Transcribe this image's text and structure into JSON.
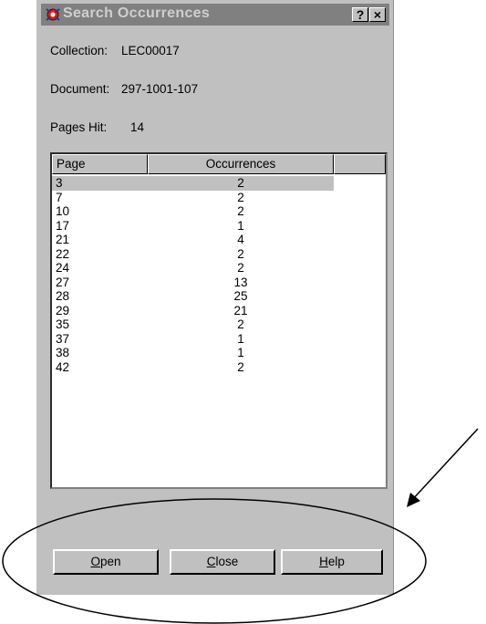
{
  "window": {
    "title": "Search Occurrences",
    "help_glyph": "?",
    "close_glyph": "×",
    "icon": "search-occurrences-app-icon"
  },
  "fields": {
    "collection_label": "Collection:",
    "collection_value": "LEC00017",
    "document_label": "Document:",
    "document_value": "297-1001-107",
    "pages_hit_label": "Pages Hit:",
    "pages_hit_value": "14"
  },
  "table": {
    "columns": [
      "Page",
      "Occurrences",
      ""
    ],
    "rows": [
      {
        "page": "3",
        "occurrences": "2",
        "selected": true
      },
      {
        "page": "7",
        "occurrences": "2"
      },
      {
        "page": "10",
        "occurrences": "2"
      },
      {
        "page": "17",
        "occurrences": "1"
      },
      {
        "page": "21",
        "occurrences": "4"
      },
      {
        "page": "22",
        "occurrences": "2"
      },
      {
        "page": "24",
        "occurrences": "2"
      },
      {
        "page": "27",
        "occurrences": "13"
      },
      {
        "page": "28",
        "occurrences": "25"
      },
      {
        "page": "29",
        "occurrences": "21"
      },
      {
        "page": "35",
        "occurrences": "2"
      },
      {
        "page": "37",
        "occurrences": "1"
      },
      {
        "page": "38",
        "occurrences": "1"
      },
      {
        "page": "42",
        "occurrences": "2"
      }
    ]
  },
  "buttons": {
    "open": {
      "mnemonic": "O",
      "rest": "pen"
    },
    "close": {
      "mnemonic": "C",
      "rest": "lose"
    },
    "help": {
      "mnemonic": "H",
      "rest": "elp"
    }
  },
  "colors": {
    "dialog_bg": "#c0c0c0",
    "title_bar": "#808080",
    "annotation": "#000000"
  }
}
